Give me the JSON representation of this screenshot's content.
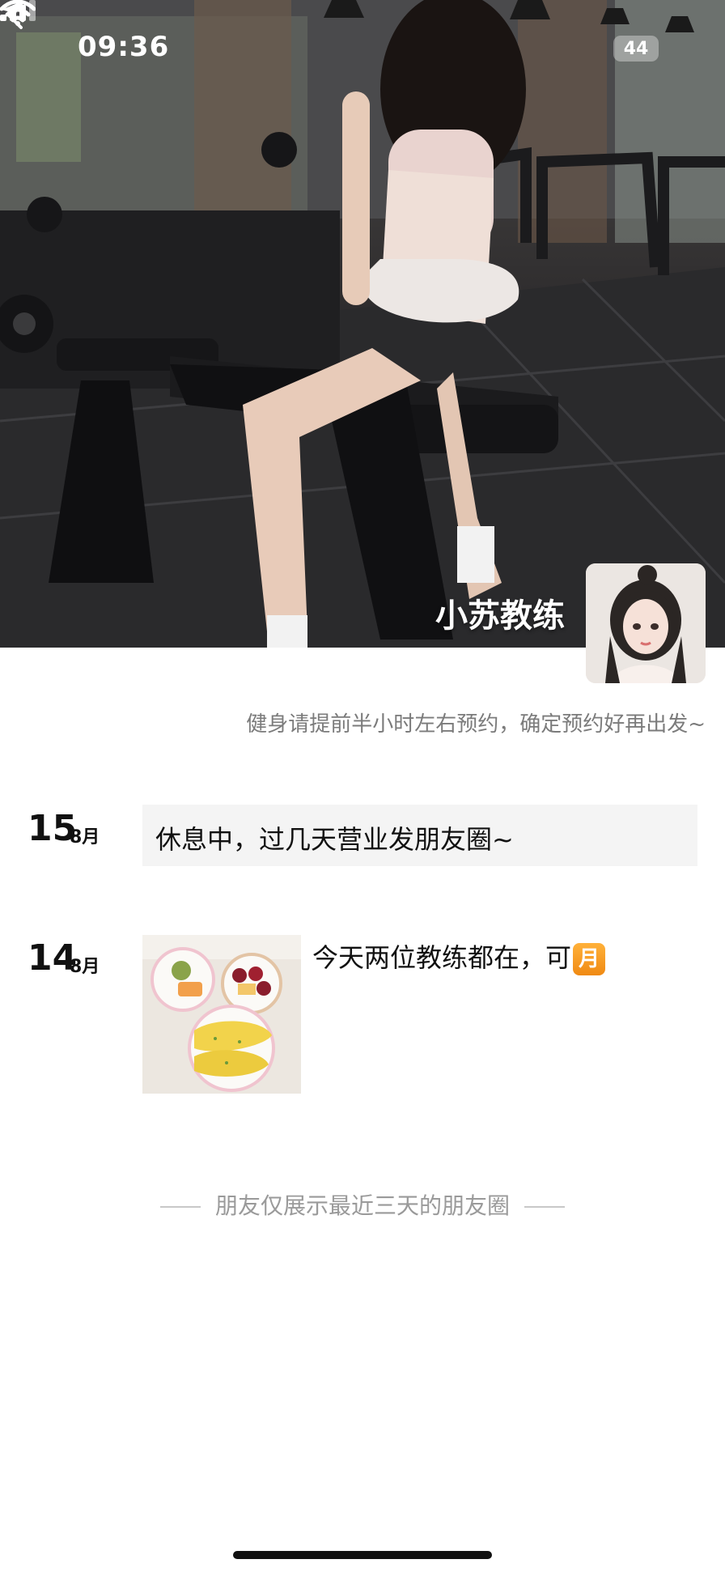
{
  "status_bar": {
    "time": "09:36",
    "battery": "44"
  },
  "profile": {
    "name": "小苏教练",
    "signature": "健身请提前半小时左右预约，确定预约好再出发~"
  },
  "posts": [
    {
      "day": "15",
      "month": "8月",
      "text": "休息中，过几天营业发朋友圈~"
    },
    {
      "day": "14",
      "month": "8月",
      "text": "今天两位教练都在，可",
      "badge": "月"
    }
  ],
  "footer": {
    "end_note": "朋友仅展示最近三天的朋友圈"
  }
}
